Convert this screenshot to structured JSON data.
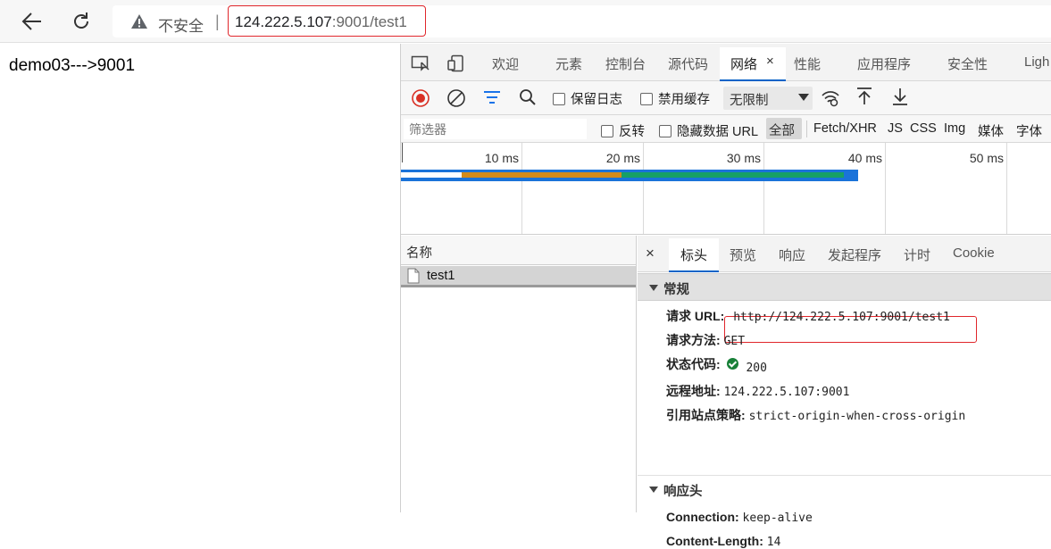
{
  "browser": {
    "security_label": "不安全",
    "address_host": "124.222.5.107",
    "address_rest": ":9001/test1"
  },
  "page": {
    "body_text": "demo03--->9001"
  },
  "devtools": {
    "tabs": [
      "欢迎",
      "元素",
      "控制台",
      "源代码",
      "网络",
      "性能",
      "应用程序",
      "安全性",
      "Ligh"
    ],
    "active_tab": "网络",
    "tab_close": "×",
    "toolbar": {
      "preserve_log": "保留日志",
      "disable_cache": "禁用缓存",
      "throttling": "无限制"
    },
    "filter": {
      "placeholder": "筛选器",
      "invert": "反转",
      "hide_data_urls": "隐藏数据 URL",
      "types": [
        "全部",
        "Fetch/XHR",
        "JS",
        "CSS",
        "Img",
        "媒体",
        "字体"
      ]
    },
    "timeline": {
      "labels": [
        "10 ms",
        "20 ms",
        "30 ms",
        "40 ms",
        "50 ms"
      ],
      "colors": {
        "outline": "#1a73d9",
        "wait": "#d38b1b",
        "download": "#16a066"
      }
    },
    "requests": {
      "header": "名称",
      "items": [
        {
          "name": "test1"
        }
      ]
    },
    "detail": {
      "close": "×",
      "tabs": [
        "标头",
        "预览",
        "响应",
        "发起程序",
        "计时",
        "Cookie"
      ],
      "active_tab": "标头",
      "general": {
        "title": "常规",
        "rows": [
          {
            "key": "请求 URL:",
            "value": "http://124.222.5.107:9001/test1"
          },
          {
            "key": "请求方法:",
            "value": "GET"
          },
          {
            "key": "状态代码:",
            "value": "200"
          },
          {
            "key": "远程地址:",
            "value": "124.222.5.107:9001"
          },
          {
            "key": "引用站点策略:",
            "value": "strict-origin-when-cross-origin"
          }
        ]
      },
      "response_headers": {
        "title": "响应头",
        "rows": [
          {
            "key": "Connection:",
            "value": "keep-alive"
          },
          {
            "key": "Content-Length:",
            "value": "14"
          }
        ]
      }
    }
  }
}
